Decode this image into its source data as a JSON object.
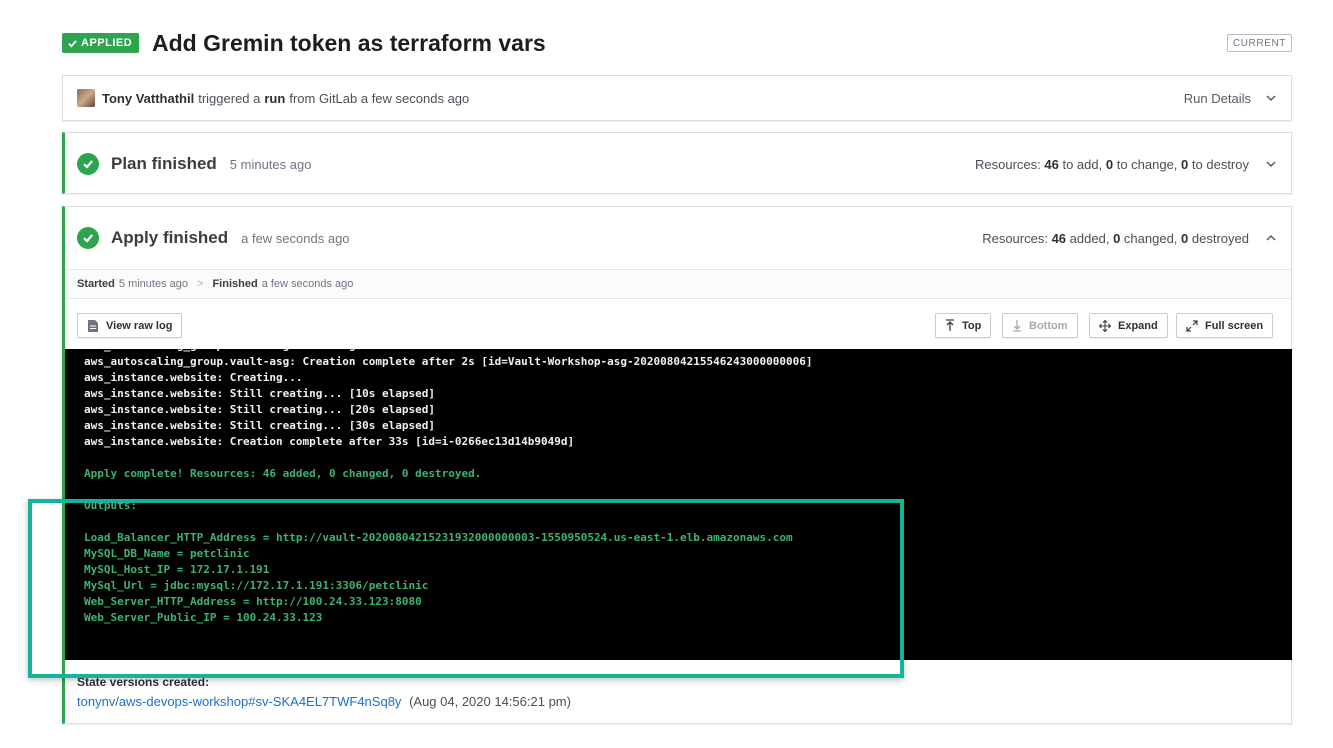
{
  "header": {
    "status_badge": "APPLIED",
    "title": "Add Gremin token as terraform vars",
    "current_badge": "CURRENT"
  },
  "trigger": {
    "user": "Tony Vatthathil",
    "text_triggered": "triggered a",
    "run_word": "run",
    "text_from": "from GitLab a few seconds ago",
    "run_details_label": "Run Details"
  },
  "plan": {
    "title": "Plan finished",
    "time": "5 minutes ago",
    "resources_label": "Resources:",
    "add_count": "46",
    "add_text": "to add,",
    "change_count": "0",
    "change_text": "to change,",
    "destroy_count": "0",
    "destroy_text": "to destroy"
  },
  "apply": {
    "title": "Apply finished",
    "time": "a few seconds ago",
    "resources_label": "Resources:",
    "added_count": "46",
    "added_text": "added,",
    "changed_count": "0",
    "changed_text": "changed,",
    "destroyed_count": "0",
    "destroyed_text": "destroyed",
    "started_label": "Started",
    "started_time": "5 minutes ago",
    "finished_label": "Finished",
    "finished_time": "a few seconds ago",
    "separator": ">"
  },
  "toolbar": {
    "view_raw_log": "View raw log",
    "top": "Top",
    "bottom": "Bottom",
    "expand": "Expand",
    "full_screen": "Full screen"
  },
  "log": [
    {
      "text": "aws_autoscaling_group.vault-asg: Creating...",
      "color": "w"
    },
    {
      "text": "aws_autoscaling_group.vault-asg: Creation complete after 2s [id=Vault-Workshop-asg-20200804215546243000000006]",
      "color": "w"
    },
    {
      "text": "aws_instance.website: Creating...",
      "color": "w"
    },
    {
      "text": "aws_instance.website: Still creating... [10s elapsed]",
      "color": "w"
    },
    {
      "text": "aws_instance.website: Still creating... [20s elapsed]",
      "color": "w"
    },
    {
      "text": "aws_instance.website: Still creating... [30s elapsed]",
      "color": "w"
    },
    {
      "text": "aws_instance.website: Creation complete after 33s [id=i-0266ec13d14b9049d]",
      "color": "w"
    },
    {
      "text": "",
      "color": "w"
    },
    {
      "text": "Apply complete! Resources: 46 added, 0 changed, 0 destroyed.",
      "color": "g"
    },
    {
      "text": "",
      "color": "w"
    },
    {
      "text": "Outputs:",
      "color": "g"
    },
    {
      "text": "",
      "color": "w"
    },
    {
      "text": "Load_Balancer_HTTP_Address = http://vault-20200804215231932000000003-1550950524.us-east-1.elb.amazonaws.com",
      "color": "g"
    },
    {
      "text": "MySQL_DB_Name = petclinic",
      "color": "g"
    },
    {
      "text": "MySQL_Host_IP = 172.17.1.191",
      "color": "g"
    },
    {
      "text": "MySql_Url = jdbc:mysql://172.17.1.191:3306/petclinic",
      "color": "g"
    },
    {
      "text": "Web_Server_HTTP_Address = http://100.24.33.123:8080",
      "color": "g"
    },
    {
      "text": "Web_Server_Public_IP = 100.24.33.123",
      "color": "g"
    }
  ],
  "state": {
    "title": "State versions created:",
    "link": "tonynv/aws-devops-workshop#sv-SKA4EL7TWF4nSq8y",
    "date": "(Aug 04, 2020 14:56:21 pm)"
  },
  "colors": {
    "success": "#2ea44f",
    "highlight": "#16b39b",
    "link": "#1c6fd1",
    "terminal_bg": "#000000",
    "terminal_green": "#3cb371"
  }
}
